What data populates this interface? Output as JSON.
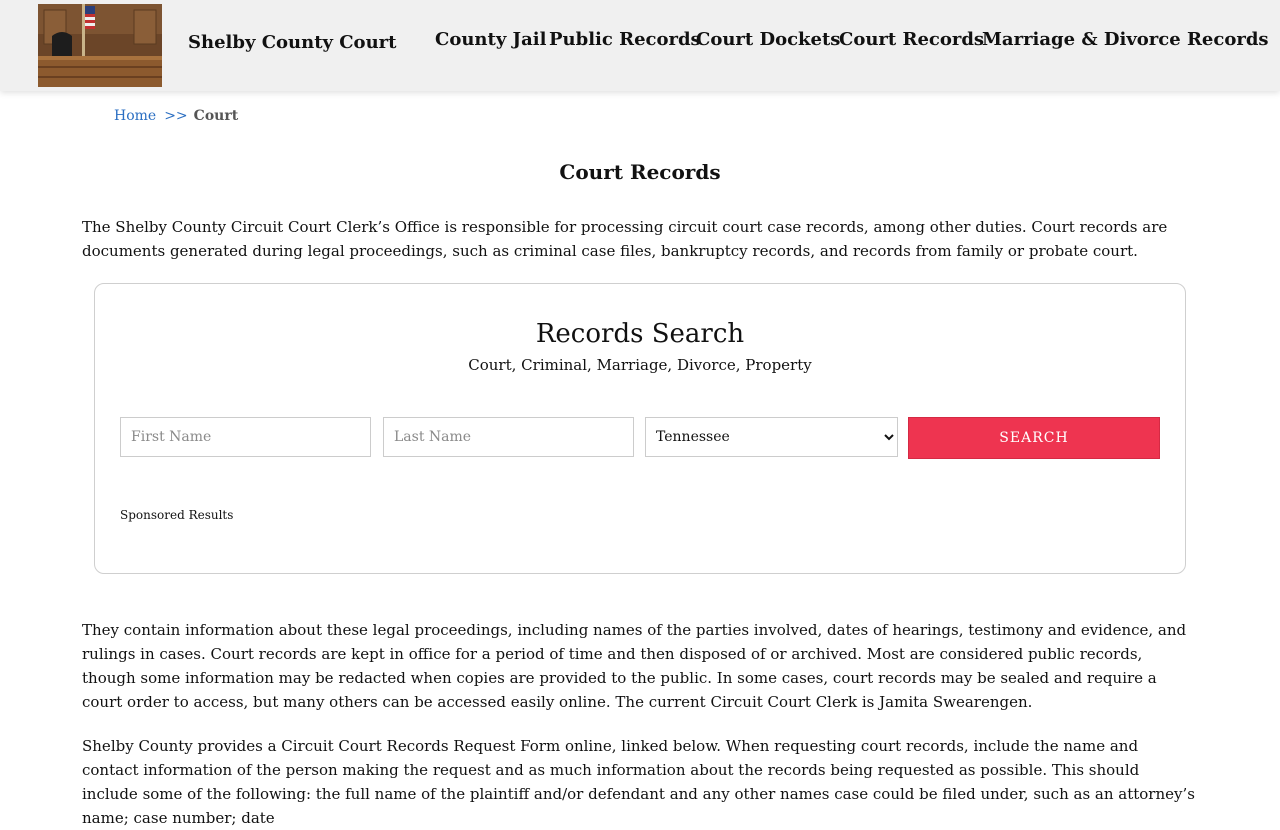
{
  "header": {
    "site_title": "Shelby County Court",
    "logo_image": "courtroom-photo"
  },
  "nav": {
    "items": [
      {
        "label": "County Jail"
      },
      {
        "label": "Public Records"
      },
      {
        "label": "Court Dockets"
      },
      {
        "label": "Court Records"
      },
      {
        "label": "Marriage & Divorce Records"
      }
    ]
  },
  "breadcrumb": {
    "home": "Home",
    "separator": ">>",
    "current": "Court"
  },
  "main": {
    "title": "Court Records",
    "intro": "The Shelby County Circuit Court Clerk’s Office is responsible for processing circuit court case records, among other duties. Court records are documents generated during legal proceedings, such as criminal case files, bankruptcy records, and records from family or probate court.",
    "para2": "They contain information about these legal proceedings, including names of the parties involved, dates of hearings, testimony and evidence, and rulings in cases. Court records are kept in office for a period of time and then disposed of or archived. Most are considered public records, though some information may be redacted when copies are provided to the public. In some cases, court records may be sealed and require a court order to access, but many others can be accessed easily online. The current Circuit Court Clerk is Jamita Swearengen.",
    "para3": "Shelby County provides a Circuit Court Records Request Form online, linked below. When requesting court records, include the name and contact information of the person making the request and as much information about the records being requested as possible. This should include some of the following: the full name of the plaintiff and/or defendant and any other names case could be filed under, such as an attorney’s name; case number; date"
  },
  "search": {
    "title": "Records Search",
    "subtitle": "Court, Criminal, Marriage, Divorce, Property",
    "first_name_placeholder": "First Name",
    "first_name_value": "",
    "last_name_placeholder": "Last Name",
    "last_name_value": "",
    "state_selected": "Tennessee",
    "button_label": "SEARCH",
    "sponsored_label": "Sponsored Results"
  },
  "colors": {
    "header_bg": "#f0f0f0",
    "link_blue": "#2a6ec2",
    "search_button": "#ee3450"
  }
}
